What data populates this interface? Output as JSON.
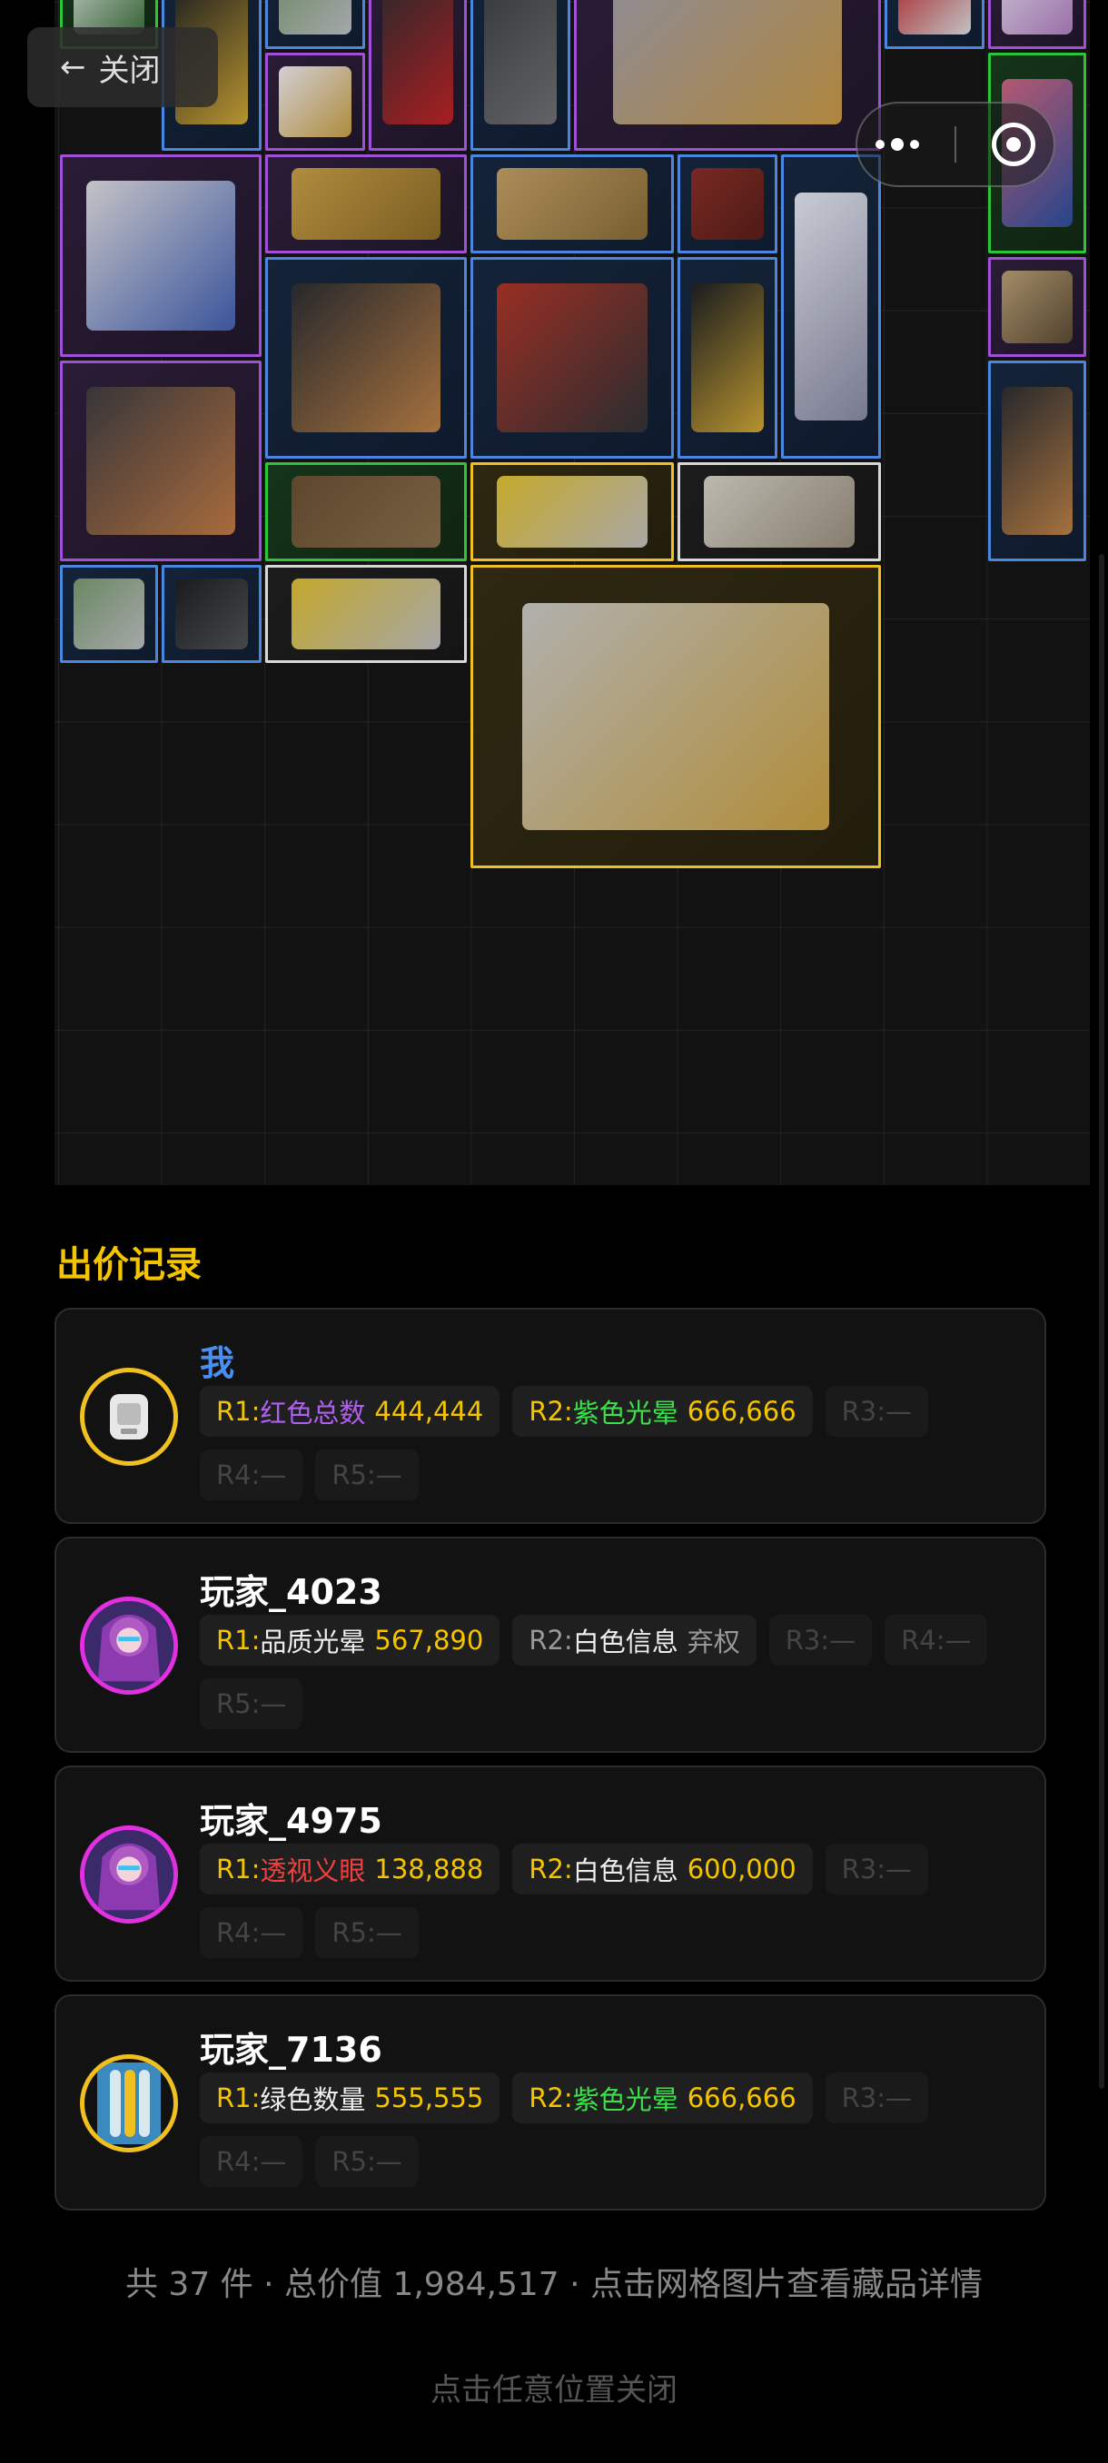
{
  "topbar": {
    "close_label": "关闭",
    "back_arrow": "←"
  },
  "inventory": {
    "items": [
      {
        "name": "keycard",
        "quality": "green"
      },
      {
        "name": "golden-flashlight",
        "quality": "blue"
      },
      {
        "name": "cd-disc",
        "quality": "blue"
      },
      {
        "name": "coffee-bag",
        "quality": "purple"
      },
      {
        "name": "remote-control",
        "quality": "blue"
      },
      {
        "name": "ornate-knife",
        "quality": "purple"
      },
      {
        "name": "cola-can",
        "quality": "blue"
      },
      {
        "name": "perfume-bottle",
        "quality": "purple"
      },
      {
        "name": "teacup",
        "quality": "purple"
      },
      {
        "name": "decorative-plate",
        "quality": "green"
      },
      {
        "name": "centrifuge",
        "quality": "purple"
      },
      {
        "name": "gold-necklace",
        "quality": "purple"
      },
      {
        "name": "honeycomb-panel",
        "quality": "blue"
      },
      {
        "name": "leather-wallet",
        "quality": "blue"
      },
      {
        "name": "microscope",
        "quality": "blue"
      },
      {
        "name": "vintage-radio",
        "quality": "purple"
      },
      {
        "name": "display-panel",
        "quality": "blue"
      },
      {
        "name": "power-drill",
        "quality": "blue"
      },
      {
        "name": "golden-flashlight",
        "quality": "blue"
      },
      {
        "name": "coffee-machine",
        "quality": "purple"
      },
      {
        "name": "display-panel",
        "quality": "blue"
      },
      {
        "name": "wood-plank",
        "quality": "green"
      },
      {
        "name": "utility-knife",
        "quality": "gold"
      },
      {
        "name": "map-papers",
        "quality": "white"
      },
      {
        "name": "cd-disc",
        "quality": "blue"
      },
      {
        "name": "action-camera",
        "quality": "blue"
      },
      {
        "name": "utility-knife",
        "quality": "white"
      },
      {
        "name": "server-rack",
        "quality": "gold"
      }
    ]
  },
  "bids": {
    "title": "出价记录",
    "records": [
      {
        "name": "我",
        "is_me": true,
        "avatar": "smartwatch-avatar",
        "rounds": [
          {
            "prefix": "R1:",
            "prefix_color": "yellow",
            "label": "红色总数",
            "label_color": "purple",
            "value": "444,444",
            "value_color": "yellow"
          },
          {
            "prefix": "R2:",
            "prefix_color": "yellow",
            "label": "紫色光晕",
            "label_color": "green",
            "value": "666,666",
            "value_color": "yellow"
          },
          {
            "prefix": "R3:",
            "empty": true,
            "value": "—"
          },
          {
            "prefix": "R4:",
            "empty": true,
            "value": "—"
          },
          {
            "prefix": "R5:",
            "empty": true,
            "value": "—"
          }
        ]
      },
      {
        "name": "玩家_4023",
        "avatar": "anime-girl-avatar",
        "rounds": [
          {
            "prefix": "R1:",
            "prefix_color": "yellow",
            "label": "品质光晕",
            "label_color": "white",
            "value": "567,890",
            "value_color": "yellow"
          },
          {
            "prefix": "R2:",
            "prefix_color": "grey",
            "label": "白色信息",
            "label_color": "white",
            "value": "弃权",
            "value_color": "grey"
          },
          {
            "prefix": "R3:",
            "empty": true,
            "value": "—"
          },
          {
            "prefix": "R4:",
            "empty": true,
            "value": "—"
          },
          {
            "prefix": "R5:",
            "empty": true,
            "value": "—"
          }
        ]
      },
      {
        "name": "玩家_4975",
        "avatar": "anime-girl-avatar",
        "rounds": [
          {
            "prefix": "R1:",
            "prefix_color": "yellow",
            "label": "透视义眼",
            "label_color": "red",
            "value": "138,888",
            "value_color": "yellow"
          },
          {
            "prefix": "R2:",
            "prefix_color": "yellow",
            "label": "白色信息",
            "label_color": "white",
            "value": "600,000",
            "value_color": "yellow"
          },
          {
            "prefix": "R3:",
            "empty": true,
            "value": "—"
          },
          {
            "prefix": "R4:",
            "empty": true,
            "value": "—"
          },
          {
            "prefix": "R5:",
            "empty": true,
            "value": "—"
          }
        ]
      },
      {
        "name": "玩家_7136",
        "avatar": "battery-avatar",
        "rounds": [
          {
            "prefix": "R1:",
            "prefix_color": "yellow",
            "label": "绿色数量",
            "label_color": "white",
            "value": "555,555",
            "value_color": "yellow"
          },
          {
            "prefix": "R2:",
            "prefix_color": "yellow",
            "label": "紫色光晕",
            "label_color": "green",
            "value": "666,666",
            "value_color": "yellow"
          },
          {
            "prefix": "R3:",
            "empty": true,
            "value": "—"
          },
          {
            "prefix": "R4:",
            "empty": true,
            "value": "—"
          },
          {
            "prefix": "R5:",
            "empty": true,
            "value": "—"
          }
        ]
      }
    ]
  },
  "footer": {
    "summary": "共 37 件 · 总价值 1,984,517 · 点击网格图片查看藏品详情",
    "close_hint": "点击任意位置关闭"
  },
  "colors": {
    "accent_yellow": "#f5c400",
    "me_blue": "#4a8ef0",
    "quality_purple": "#a050d8",
    "quality_blue": "#4a86e0",
    "quality_gold": "#f0c020",
    "quality_green": "#2ec43a",
    "quality_white": "#d8d8d8"
  }
}
